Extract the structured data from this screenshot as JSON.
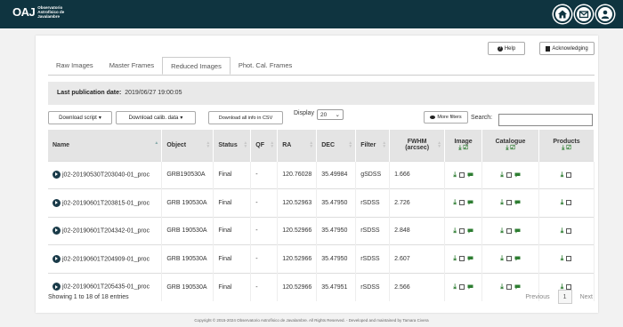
{
  "brand": {
    "short": "OAJ",
    "lines": [
      "Observatorio",
      "Astrofísico de",
      "Javalambre"
    ]
  },
  "top_icons": [
    "home-icon",
    "mail-icon",
    "user-icon"
  ],
  "buttons": {
    "help": "Help",
    "ack": "Acknowledging"
  },
  "tabs": [
    "Raw Images",
    "Master Frames",
    "Reduced Images",
    "Phot. Cal. Frames"
  ],
  "active_tab": "Reduced Images",
  "pub": {
    "label": "Last publication date:",
    "value": "2019/06/27 19:00:05"
  },
  "controls": {
    "download_script": "Download script",
    "download_calib": "Download calib. data",
    "download_csv": "Download all info in CSV",
    "display_label": "Display",
    "display_value": "20",
    "more_filters": "More filters",
    "search_label": "Search:"
  },
  "table": {
    "headers": [
      "Name",
      "Object",
      "Status",
      "QF",
      "RA",
      "DEC",
      "Filter",
      "FWHM (arcsec)",
      "Image",
      "Catalogue",
      "Products"
    ],
    "rows": [
      {
        "name": "j02-20190530T203040-01_proc",
        "object": "GRB190530A",
        "status": "Final",
        "qf": "-",
        "ra": "120.76028",
        "dec": "35.49984",
        "filter": "gSDSS",
        "fwhm": "1.666"
      },
      {
        "name": "j02-20190601T203815-01_proc",
        "object": "GRB 190530A",
        "status": "Final",
        "qf": "-",
        "ra": "120.52963",
        "dec": "35.47950",
        "filter": "rSDSS",
        "fwhm": "2.726"
      },
      {
        "name": "j02-20190601T204342-01_proc",
        "object": "GRB 190530A",
        "status": "Final",
        "qf": "-",
        "ra": "120.52966",
        "dec": "35.47950",
        "filter": "rSDSS",
        "fwhm": "2.848"
      },
      {
        "name": "j02-20190601T204909-01_proc",
        "object": "GRB 190530A",
        "status": "Final",
        "qf": "-",
        "ra": "120.52966",
        "dec": "35.47950",
        "filter": "rSDSS",
        "fwhm": "2.607"
      },
      {
        "name": "j02-20190601T205435-01_proc",
        "object": "GRB 190530A",
        "status": "Final",
        "qf": "-",
        "ra": "120.52966",
        "dec": "35.47951",
        "filter": "rSDSS",
        "fwhm": "2.566"
      }
    ]
  },
  "footer": {
    "showing": "Showing 1 to 18 of 18 entries",
    "previous": "Previous",
    "page": "1",
    "next": "Next",
    "copyright": "Copyright © 2015-2024 Observatorio Astrofísico de Javalambre. All Rights Reserved. - Developed and maintained by Tamara Civera"
  },
  "colors": {
    "topbar": "#0f3440",
    "green": "#2e7d32"
  }
}
